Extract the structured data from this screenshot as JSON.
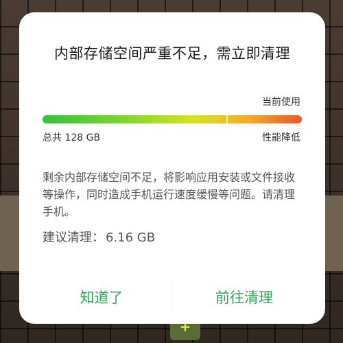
{
  "dialog": {
    "title": "内部存储空间严重不足，需立即清理",
    "current_usage_label": "当前使用",
    "storage_usage_fraction": 0.71,
    "total_label": "总共 128 GB",
    "performance_label": "性能降低",
    "message": "剩余内部存储空间不足，将影响应用安装或文件接收等操作，同时造成手机运行速度缓慢等问题。请清理手机。",
    "suggest_label": "建议清理：",
    "suggest_amount": "6.16 GB",
    "dismiss_button": "知道了",
    "clean_button": "前往清理"
  },
  "colors": {
    "accent": "#2ea85a",
    "bar_start": "#2fc53a",
    "bar_end": "#f0552c"
  },
  "background": {
    "app_icon": "plus-icon"
  }
}
